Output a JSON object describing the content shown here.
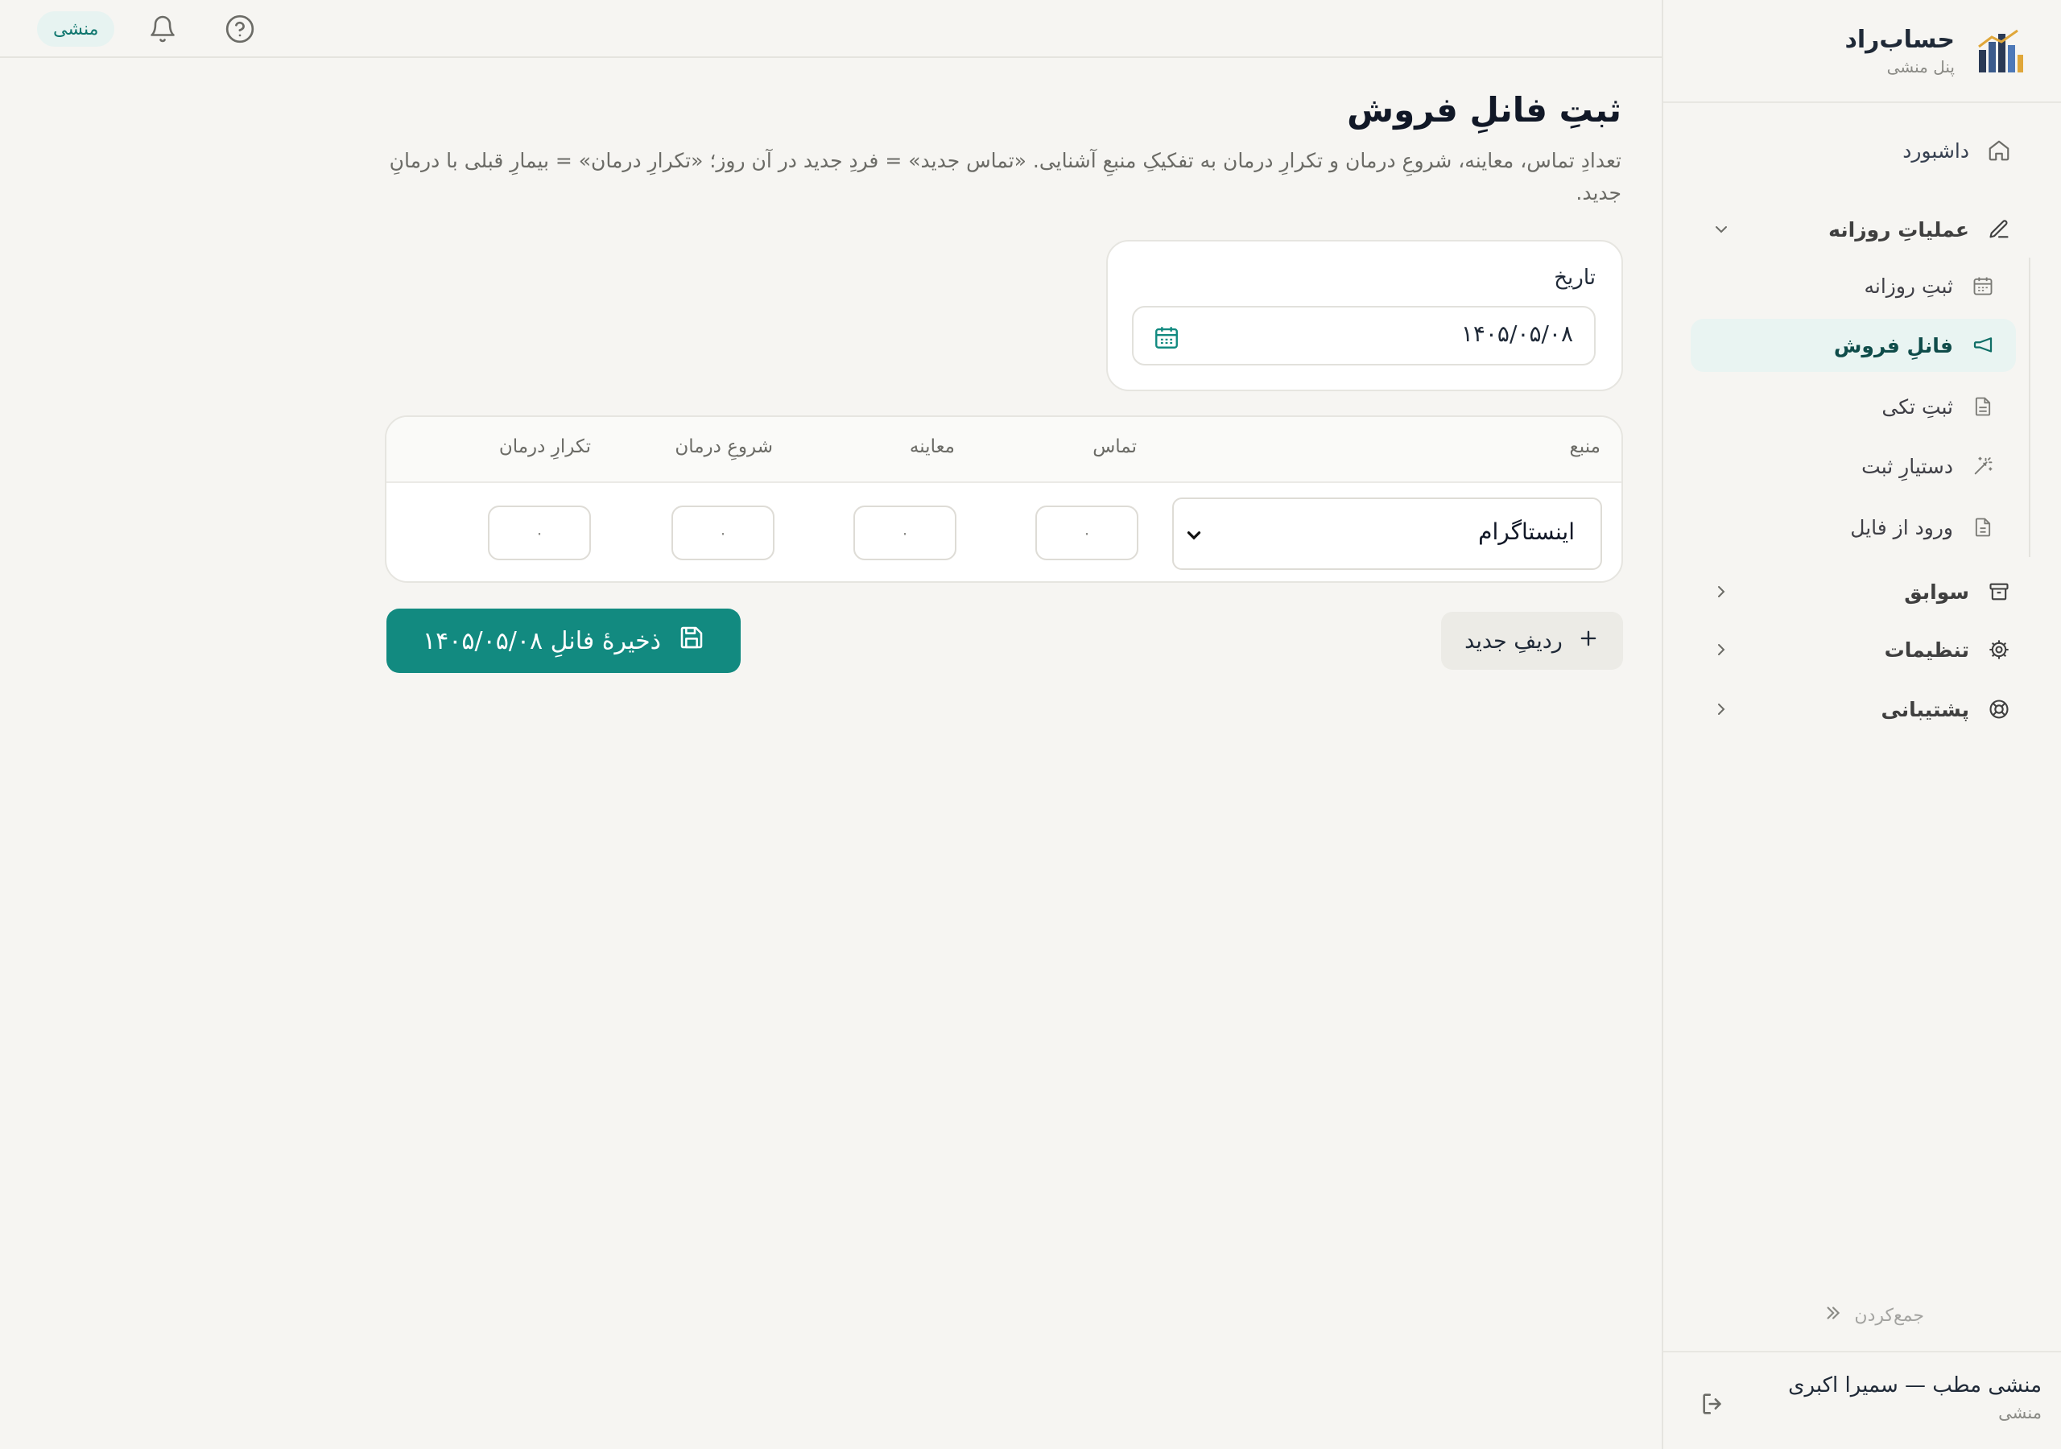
{
  "colors": {
    "accent": "#128a80",
    "accent_dark": "#0f4c4a",
    "active_bg": "#e9f4f2",
    "page_bg": "#f6f5f2"
  },
  "brand": {
    "name": "حساب‌راد",
    "subtitle": "پنل منشی",
    "logo_icon": "bar-chart-building-logo"
  },
  "sidebar": {
    "dashboard": {
      "label": "داشبورد",
      "icon": "home-icon"
    },
    "daily_ops": {
      "label": "عملیاتِ روزانه",
      "icon": "pencil-icon",
      "expanded": true,
      "items": [
        {
          "label": "ثبتِ روزانه",
          "icon": "calendar-icon",
          "active": false
        },
        {
          "label": "فانلِ فروش",
          "icon": "megaphone-icon",
          "active": true
        },
        {
          "label": "ثبتِ تکی",
          "icon": "document-icon",
          "active": false
        },
        {
          "label": "دستیارِ ثبت",
          "icon": "magic-wand-icon",
          "active": false
        },
        {
          "label": "ورود از فایل",
          "icon": "file-import-icon",
          "active": false
        }
      ]
    },
    "history": {
      "label": "سوابق",
      "icon": "archive-icon"
    },
    "settings": {
      "label": "تنظیمات",
      "icon": "gear-icon"
    },
    "support": {
      "label": "پشتیبانی",
      "icon": "lifebuoy-icon"
    },
    "collapse_label": "جمع‌کردن",
    "user": {
      "name": "منشی مطب — سمیرا اکبری",
      "role": "منشی"
    }
  },
  "topbar": {
    "role_badge": "منشی"
  },
  "main": {
    "title": "ثبتِ فانلِ فروش",
    "description": "تعدادِ تماس، معاینه، شروعِ درمان و تکرارِ درمان به تفکیکِ منبعِ آشنایی. «تماس جدید» = فردِ جدید در آن روز؛ «تکرارِ درمان» = بیمارِ قبلی با درمانِ جدید.",
    "date": {
      "label": "تاریخ",
      "value": "۱۴۰۵/۰۵/۰۸"
    },
    "table": {
      "headers": [
        "منبع",
        "تماس",
        "معاینه",
        "شروعِ درمان",
        "تکرارِ درمان"
      ],
      "rows": [
        {
          "source": "اینستاگرام",
          "contact": "۰",
          "exam": "۰",
          "start": "۰",
          "repeat": "۰"
        }
      ]
    },
    "add_row_label": "ردیفِ جدید",
    "save_label": "ذخیرهٔ فانلِ ۱۴۰۵/۰۵/۰۸"
  }
}
